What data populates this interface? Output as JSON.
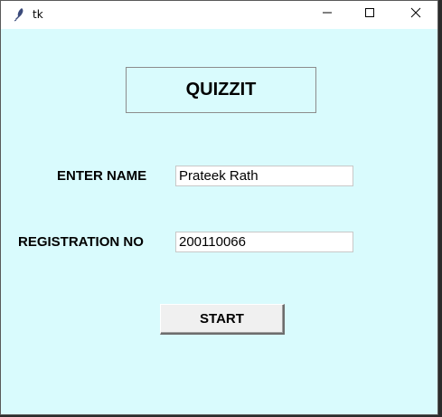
{
  "window": {
    "title": "tk",
    "controls": {
      "minimize": "minimize",
      "maximize": "maximize",
      "close": "close"
    }
  },
  "app": {
    "heading": "QUIZZIT",
    "name_label": "ENTER NAME",
    "name_value": "Prateek Rath",
    "reg_label": "REGISTRATION NO",
    "reg_value": "200110066",
    "start_label": "START"
  },
  "colors": {
    "background": "#d9fbfd",
    "button": "#f0f0f0"
  },
  "icons": [
    "feather-icon",
    "minimize-icon",
    "maximize-icon",
    "close-icon"
  ]
}
